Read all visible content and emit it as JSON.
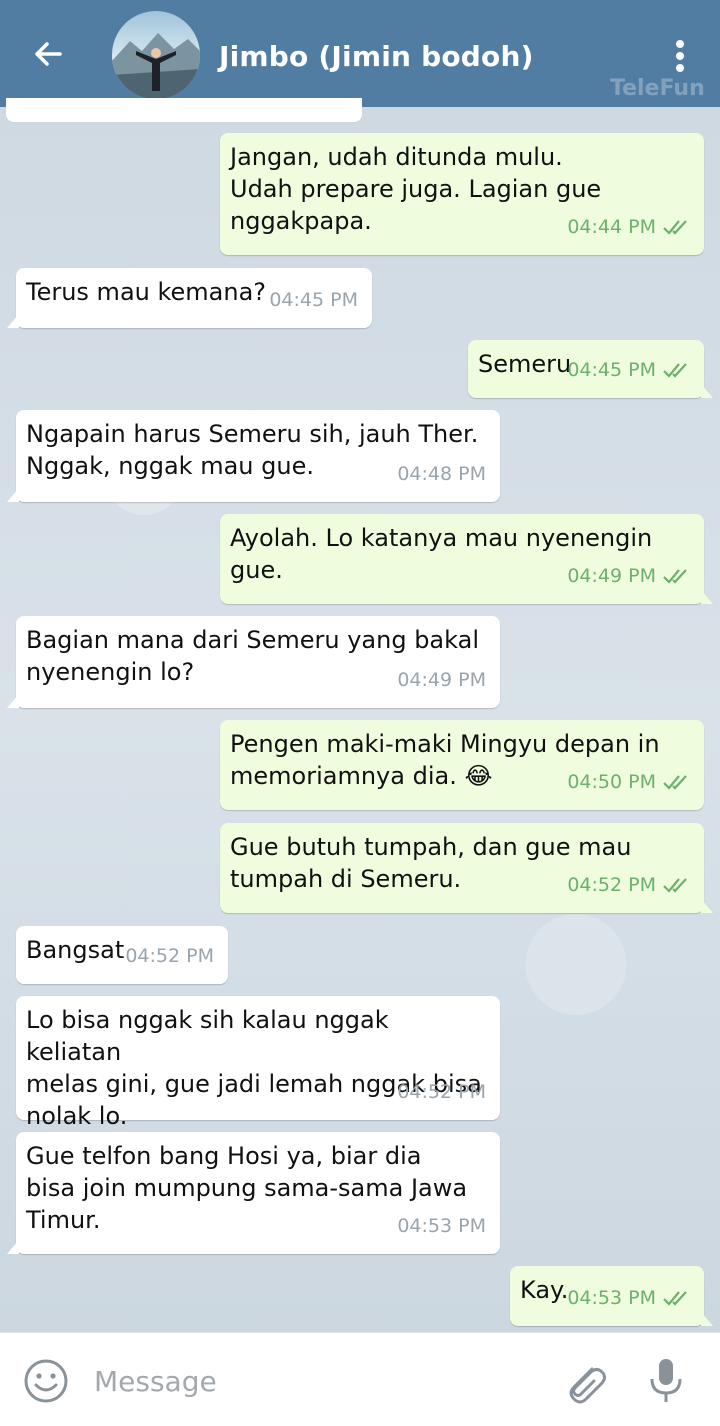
{
  "header": {
    "title": "Jimbo (Jimin bodoh)",
    "watermark": "TeleFun",
    "back_icon": "arrow-left-icon",
    "menu_icon": "more-vertical-icon",
    "bg_color": "#527da3"
  },
  "messages": [
    {
      "dir": "out",
      "text": "Jangan, udah ditunda mulu.\nUdah prepare juga. Lagian gue\nnggakpapa.",
      "time": "04:44 PM",
      "read": true
    },
    {
      "dir": "in",
      "text": "Terus mau kemana?",
      "time": "04:45 PM"
    },
    {
      "dir": "out",
      "text": "Semeru",
      "time": "04:45 PM",
      "read": true
    },
    {
      "dir": "in",
      "text": "Ngapain harus Semeru sih, jauh Ther.\nNggak, nggak mau gue.",
      "time": "04:48 PM"
    },
    {
      "dir": "out",
      "text": "Ayolah. Lo katanya mau nyenengin\ngue.",
      "time": "04:49 PM",
      "read": true
    },
    {
      "dir": "in",
      "text": "Bagian mana dari Semeru yang bakal\nnyenengin lo?",
      "time": "04:49 PM"
    },
    {
      "dir": "out",
      "text": "Pengen maki-maki Mingyu depan in\nmemoriamnya dia. 😂",
      "time": "04:50 PM",
      "read": true
    },
    {
      "dir": "out",
      "text": "Gue butuh tumpah, dan gue mau\ntumpah di Semeru.",
      "time": "04:52 PM",
      "read": true
    },
    {
      "dir": "in",
      "text": "Bangsat",
      "time": "04:52 PM"
    },
    {
      "dir": "in",
      "text": "Lo bisa nggak sih kalau nggak keliatan\nmelas gini, gue jadi lemah nggak bisa\nnolak lo.",
      "time": "04:52 PM"
    },
    {
      "dir": "in",
      "text": "Gue telfon bang Hosi ya, biar dia\nbisa join mumpung sama-sama Jawa\nTimur.",
      "time": "04:53 PM"
    },
    {
      "dir": "out",
      "text": "Kay.",
      "time": "04:53 PM",
      "read": true
    }
  ],
  "composer": {
    "placeholder": "Message",
    "emoji_icon": "smile-icon",
    "attach_icon": "paperclip-icon",
    "mic_icon": "microphone-icon"
  },
  "colors": {
    "incoming_bubble": "#ffffff",
    "outgoing_bubble": "#effdde",
    "read_check": "#6db06d"
  }
}
